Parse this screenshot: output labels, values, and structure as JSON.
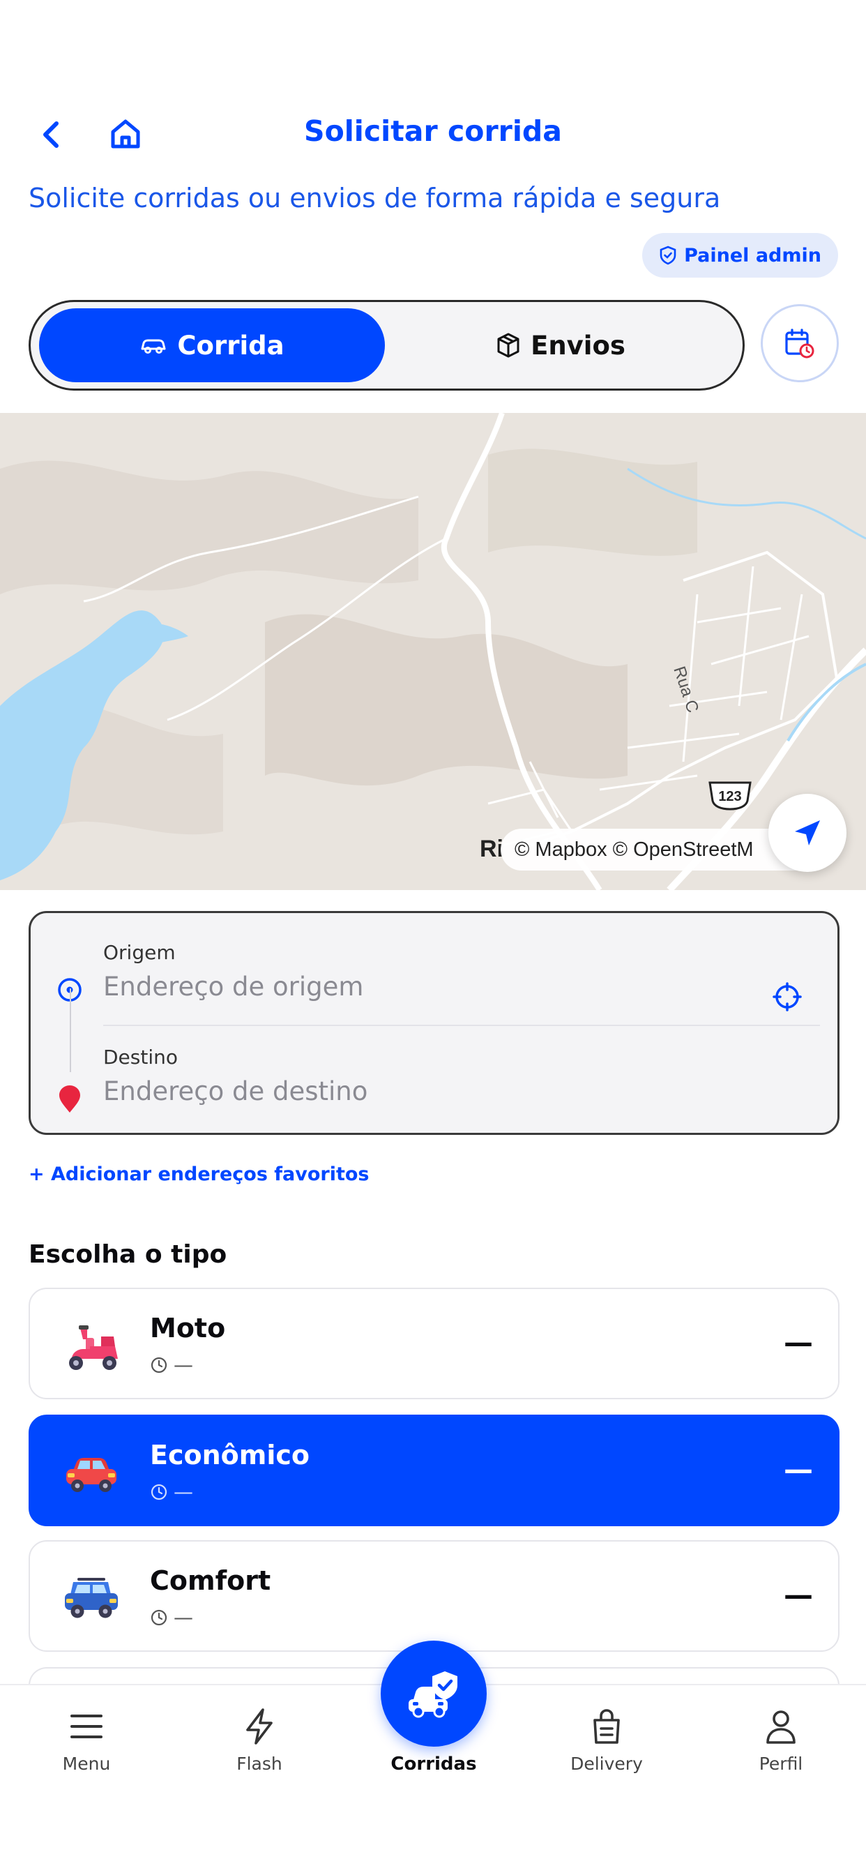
{
  "header": {
    "title": "Solicitar corrida",
    "back_icon": "chevron-left-icon",
    "home_icon": "home-icon"
  },
  "subtitle": "Solicite corridas ou envios de forma rápida e segura",
  "admin_badge": {
    "label": "Painel admin",
    "icon": "shield-icon"
  },
  "mode_tabs": [
    {
      "label": "Corrida",
      "icon": "car-icon",
      "selected": true
    },
    {
      "label": "Envios",
      "icon": "package-icon",
      "selected": false
    }
  ],
  "schedule_icon": "calendar-clock-icon",
  "map": {
    "attribution": "© Mapbox © OpenStreetM",
    "place_fragment": "Ri",
    "road_label": "Rua C",
    "route_shield": "123"
  },
  "address": {
    "origin_label": "Origem",
    "origin_placeholder": "Endereço de origem",
    "destination_label": "Destino",
    "destination_placeholder": "Endereço de destino"
  },
  "favorites_link": "+ Adicionar endereços favoritos",
  "ride_section_title": "Escolha o tipo",
  "ride_options": [
    {
      "name": "Moto",
      "eta": "—",
      "price": "—",
      "selected": false,
      "icon": "scooter-icon"
    },
    {
      "name": "Econômico",
      "eta": "—",
      "price": "—",
      "selected": true,
      "icon": "red-car-icon"
    },
    {
      "name": "Comfort",
      "eta": "—",
      "price": "—",
      "selected": false,
      "icon": "suv-icon"
    }
  ],
  "nav": {
    "menu": "Menu",
    "flash": "Flash",
    "rides": "Corridas",
    "delivery": "Delivery",
    "profile": "Perfil"
  },
  "colors": {
    "primary": "#0047ff",
    "badge_bg": "#e4ebfb",
    "destination_pin": "#e8253f",
    "water": "#a8d9f7"
  }
}
